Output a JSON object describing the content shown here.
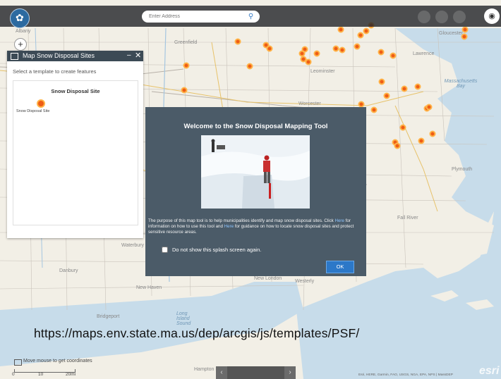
{
  "toolbar": {
    "search_placeholder": "Enter Address",
    "search_icon": "search-icon",
    "logo_icon": "massachusetts-seal-logo",
    "visibility_icon": "eye-icon"
  },
  "zoom": {
    "in_label": "+",
    "out_label": "-",
    "home_icon": "home-icon"
  },
  "template_panel": {
    "title": "Map Snow Disposal Sites",
    "minimize_label": "–",
    "close_label": "✕",
    "instruction": "Select a template to create features",
    "heading": "Snow Disposal Site",
    "item_label": "Snow Disposal Site",
    "symbol_color": "#ee5d16"
  },
  "splash": {
    "title": "Welcome to the Snow Disposal Mapping Tool",
    "body_1": "The purpose of this map tool is to help municipalities identify and map snow disposal sites. Click ",
    "link_1": "Here",
    "body_2": " for information on how to use this tool and ",
    "link_2": "Here",
    "body_3": " for guidance on how to locate snow disposal sites and protect sensitive resource areas.",
    "checkbox_label": "Do not show this splash screen again.",
    "ok_label": "OK",
    "background_color": "#4b5b68"
  },
  "url_caption": "https://maps.env.state.ma.us/dep/arcgis/js/templates/PSF/",
  "status": {
    "coordinates_label": "Move mouse to get coordinates",
    "scale_0": "0",
    "scale_10": "10",
    "scale_20": "20mi"
  },
  "time_slider": {
    "prev_label": "‹",
    "next_label": "›"
  },
  "attribution": "Esri, HERE, Garmin, FAO, USGS, NGA, EPA, NPS | MassDEP",
  "esri_logo": "esri",
  "places": {
    "albany": "Albany",
    "greenfield": "Greenfield",
    "leominster": "Leominster",
    "gloucester": "Gloucester",
    "lawrence": "Lawrence",
    "massachusetts_bay": "Massachusetts Bay",
    "worcester": "Worcester",
    "plymouth": "Plymouth",
    "fall_river": "Fall River",
    "waterbury": "Waterbury",
    "danbury": "Danbury",
    "new_haven": "New Haven",
    "new_london": "New London",
    "westerly": "Westerly",
    "bridgeport": "Bridgeport",
    "long_island_sound": "Long Island Sound",
    "hampton": "Hampton B..."
  }
}
